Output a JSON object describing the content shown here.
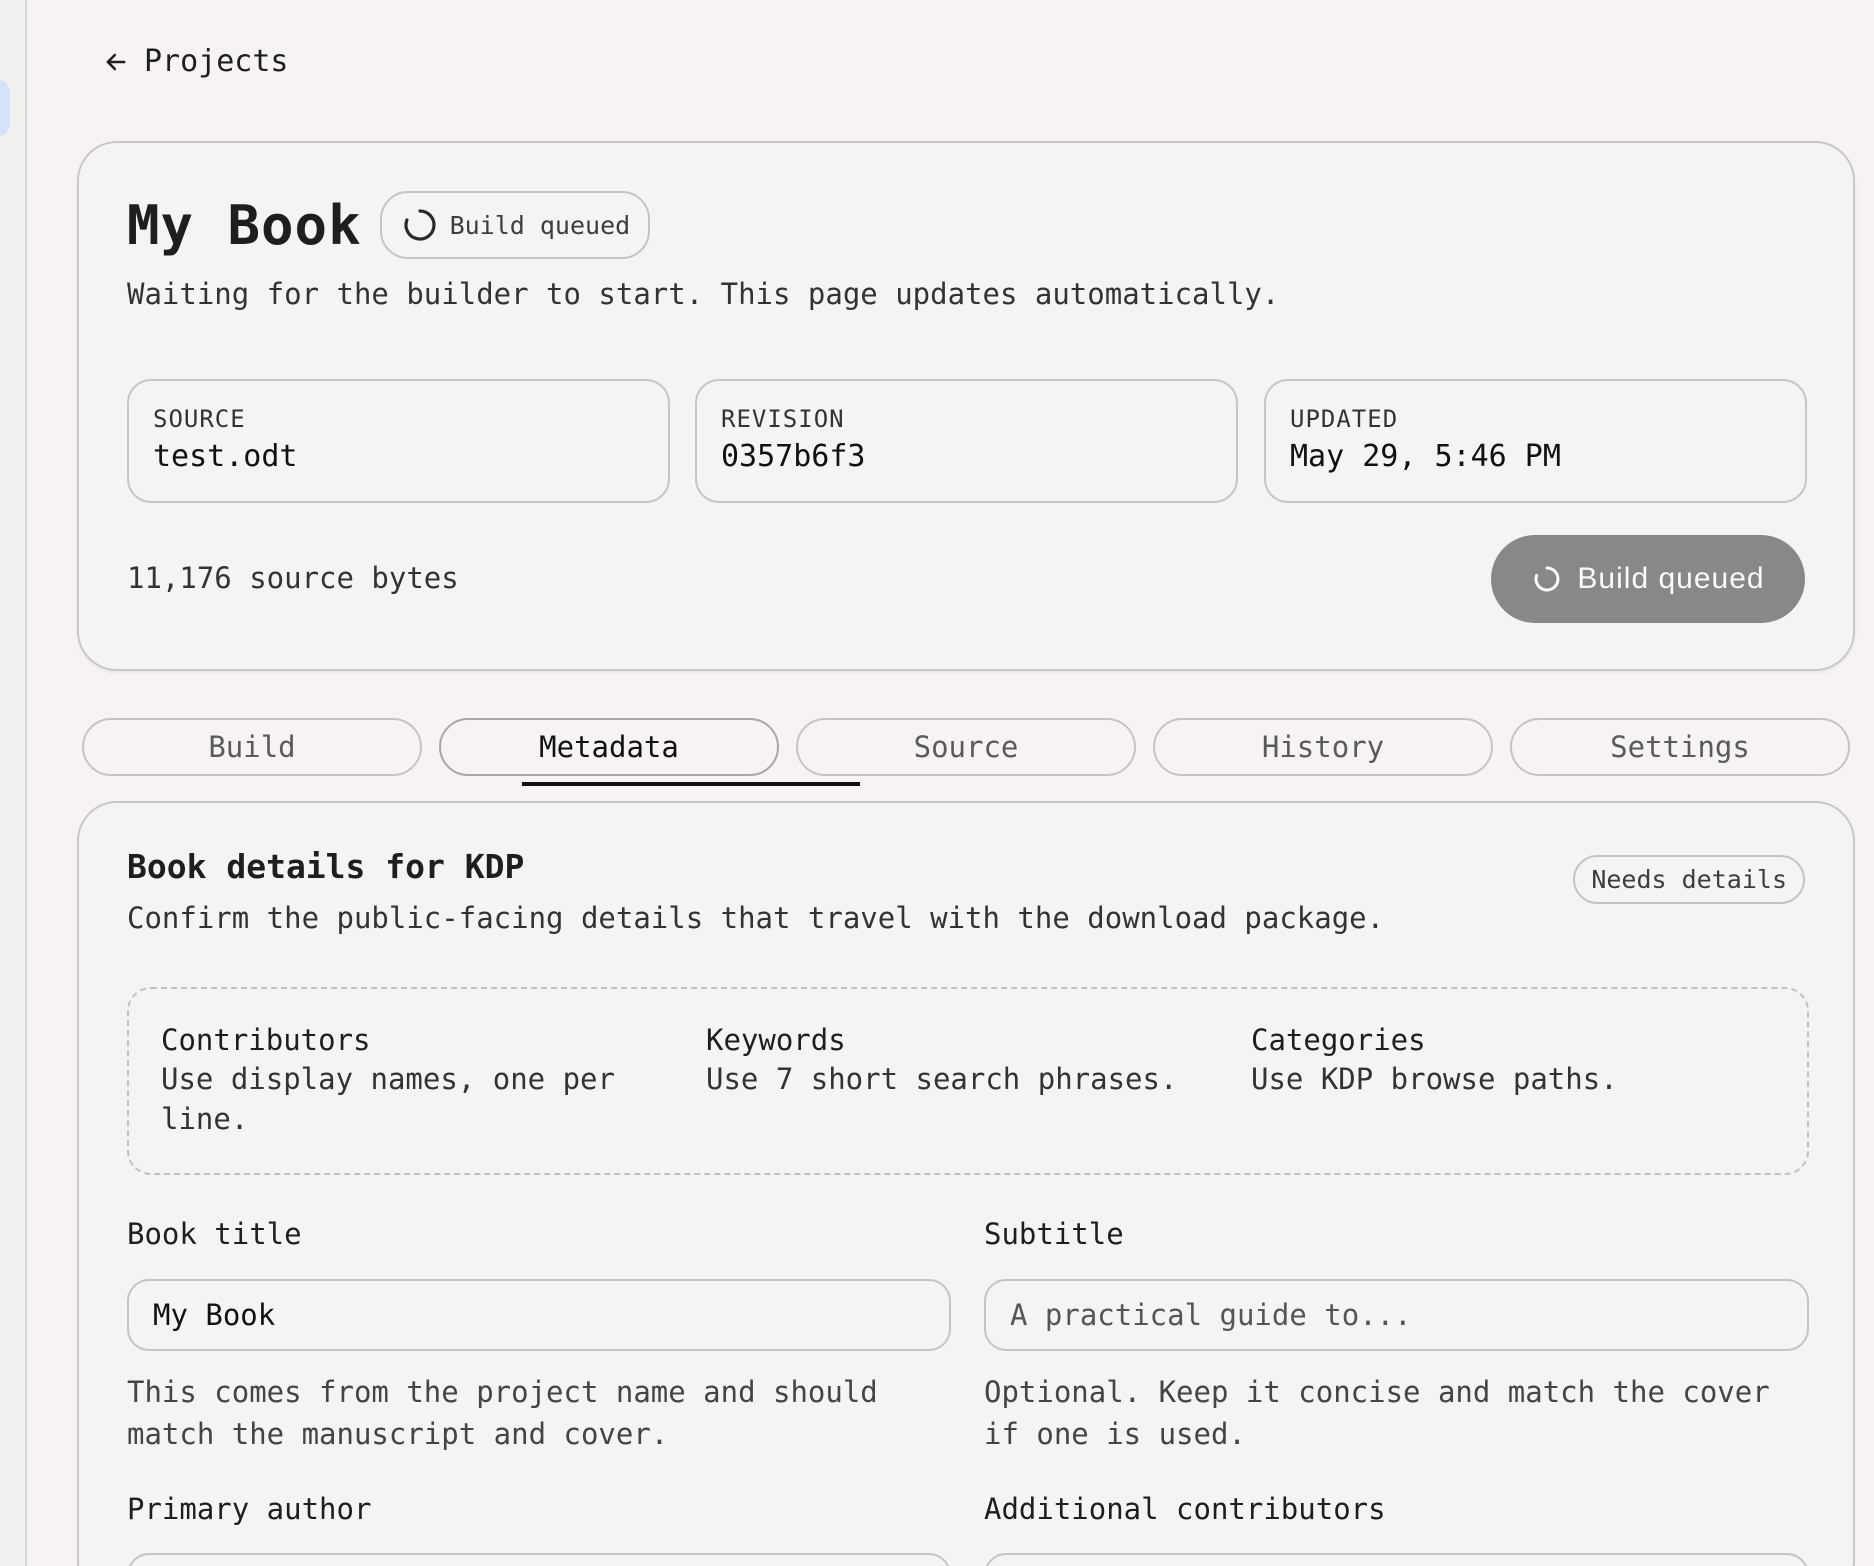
{
  "nav": {
    "back_label": "Projects"
  },
  "hero": {
    "title": "My Book",
    "status_pill": "Build queued",
    "subtitle": "Waiting for the builder to start. This page updates automatically.",
    "source_label": "SOURCE",
    "source_value": "test.odt",
    "revision_label": "REVISION",
    "revision_value": "0357b6f3",
    "updated_label": "UPDATED",
    "updated_value": "May 29, 5:46 PM",
    "bytes_text": "11,176 source bytes",
    "build_button": "Build queued"
  },
  "tabs": [
    "Build",
    "Metadata",
    "Source",
    "History",
    "Settings"
  ],
  "active_tab": "Metadata",
  "details": {
    "title": "Book details for KDP",
    "subtitle": "Confirm the public-facing details that travel with the download package.",
    "status_pill": "Needs details",
    "hints": [
      {
        "title": "Contributors",
        "body": "Use display names, one per line."
      },
      {
        "title": "Keywords",
        "body": "Use 7 short search phrases."
      },
      {
        "title": "Categories",
        "body": "Use KDP browse paths."
      }
    ],
    "book_title_label": "Book title",
    "book_title_value": "My Book",
    "book_title_help": "This comes from the project name and should match the manuscript and cover.",
    "subtitle_label": "Subtitle",
    "subtitle_placeholder": "A practical guide to...",
    "subtitle_help": "Optional. Keep it concise and match the cover if one is used.",
    "primary_author_label": "Primary author",
    "additional_contributors_label": "Additional contributors"
  },
  "colors": {
    "background": "#f6f3f2",
    "card_border": "#c9c7c5",
    "button_bg": "#898888",
    "text": "#1e1e1e"
  }
}
